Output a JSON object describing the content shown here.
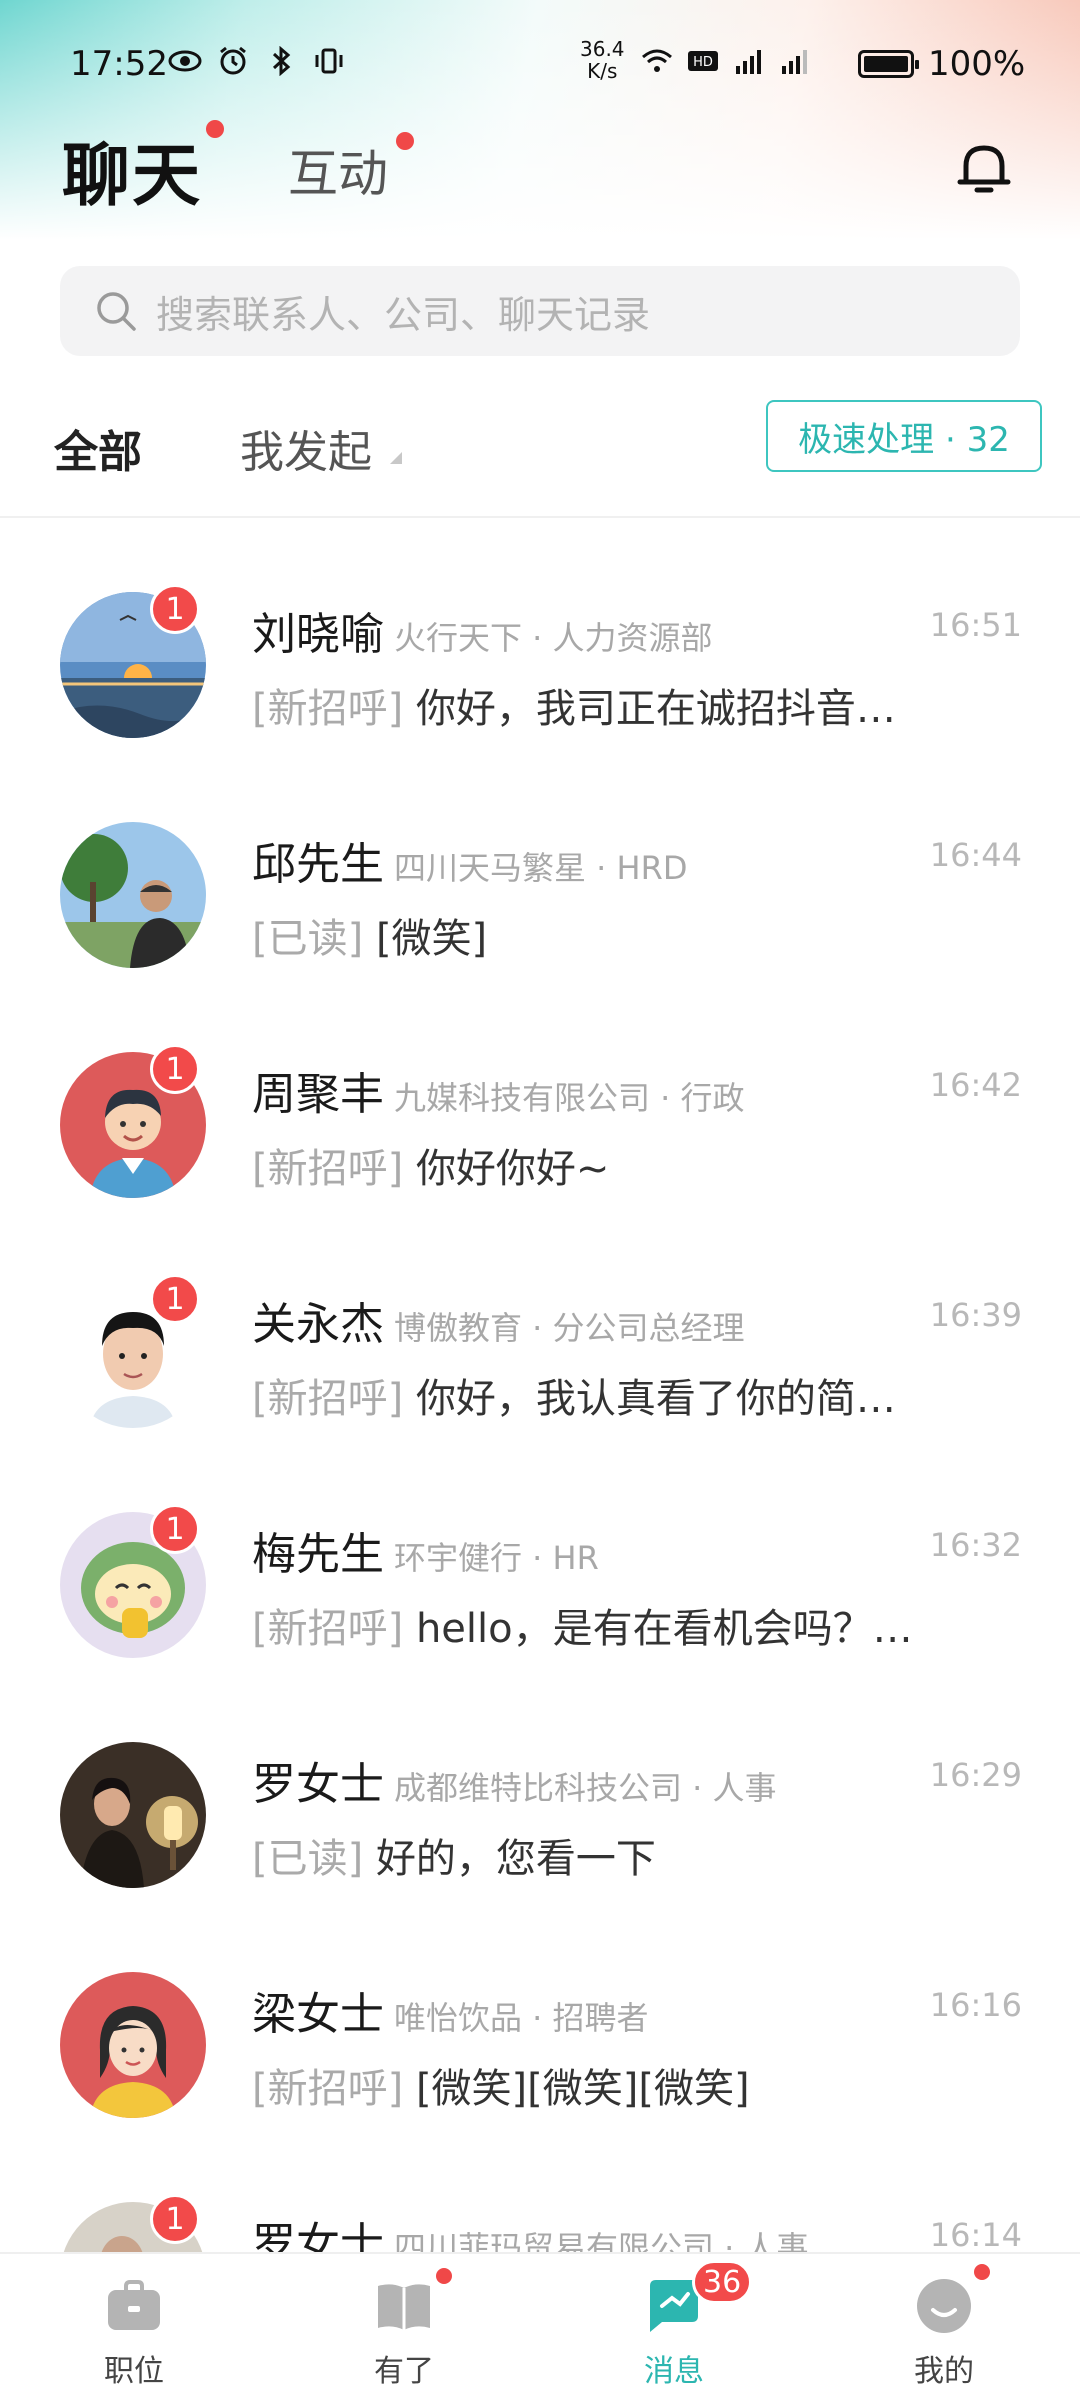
{
  "status_bar": {
    "time": "17:52",
    "net_speed_value": "36.4",
    "net_speed_unit": "K/s",
    "battery": "100%"
  },
  "header": {
    "tab_chat": "聊天",
    "tab_interact": "互动"
  },
  "search": {
    "placeholder": "搜索联系人、公司、聊天记录"
  },
  "filters": {
    "all": "全部",
    "mine": "我发起",
    "quick_process": "极速处理 · 32"
  },
  "chats": [
    {
      "name": "刘晓喻",
      "company": "火行天下 · 人力资源部",
      "time": "16:51",
      "tag": "[新招呼]",
      "message": "你好，我司正在诚招抖音…",
      "badge": "1",
      "avatar": "sunset-photo"
    },
    {
      "name": "邱先生",
      "company": "四川天马繁星 · HRD",
      "time": "16:44",
      "tag": "[已读]",
      "message": "[微笑]",
      "badge": "",
      "avatar": "outdoor-photo"
    },
    {
      "name": "周聚丰",
      "company": "九媒科技有限公司 · 行政",
      "time": "16:42",
      "tag": "[新招呼]",
      "message": "你好你好~",
      "badge": "1",
      "avatar": "cartoon-man"
    },
    {
      "name": "关永杰",
      "company": "博傲教育 · 分公司总经理",
      "time": "16:39",
      "tag": "[新招呼]",
      "message": "你好，我认真看了你的简…",
      "badge": "1",
      "avatar": "portrait-photo"
    },
    {
      "name": "梅先生",
      "company": "环宇健行 · HR",
      "time": "16:32",
      "tag": "[新招呼]",
      "message": "hello，是有在看机会吗？…",
      "badge": "1",
      "avatar": "cartoon-dino"
    },
    {
      "name": "罗女士",
      "company": "成都维特比科技公司 · 人事",
      "time": "16:29",
      "tag": "[已读]",
      "message": "好的，您看一下",
      "badge": "",
      "avatar": "lamp-photo"
    },
    {
      "name": "梁女士",
      "company": "唯怡饮品 · 招聘者",
      "time": "16:16",
      "tag": "[新招呼]",
      "message": "[微笑][微笑][微笑]",
      "badge": "",
      "avatar": "cartoon-woman"
    },
    {
      "name": "罗女士",
      "company": "四川菲玛贸易有限公司 · 人事",
      "time": "16:14",
      "tag": "",
      "message": "",
      "badge": "1",
      "avatar": "partial-photo"
    }
  ],
  "bottom_nav": {
    "jobs": "职位",
    "youle": "有了",
    "messages": "消息",
    "messages_badge": "36",
    "mine": "我的"
  },
  "colors": {
    "accent": "#2cb6b0",
    "badge_red": "#f24a4a",
    "muted_text": "#aaaaaa"
  }
}
